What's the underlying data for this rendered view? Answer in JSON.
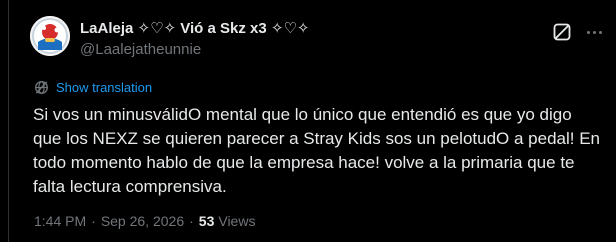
{
  "tweet": {
    "display_name": "LaAleja ✧♡✧ Vió a Skz x3 ✧♡✧",
    "handle": "@Laalejatheunnie",
    "translate_label": "Show translation",
    "text": "Si vos un minusválidO mental que lo único que entendió es que yo digo que los NEXZ se quieren parecer a Stray Kids sos un pelotudO a pedal! En todo momento hablo de que la empresa hace! volve a la primaria que te falta lectura comprensiva.",
    "time": "1:44 PM",
    "separator": "·",
    "date": "Sep 26, 2026",
    "views_count": "53",
    "views_label": "Views"
  },
  "icons": {
    "avatar": "avatar-image",
    "grok": "grok-icon",
    "more": "more-icon",
    "translate": "globe-icon"
  },
  "colors": {
    "background": "#000000",
    "text_primary": "#e7e9ea",
    "text_secondary": "#71767b",
    "link": "#1d9bf0",
    "border": "#2f3336"
  }
}
